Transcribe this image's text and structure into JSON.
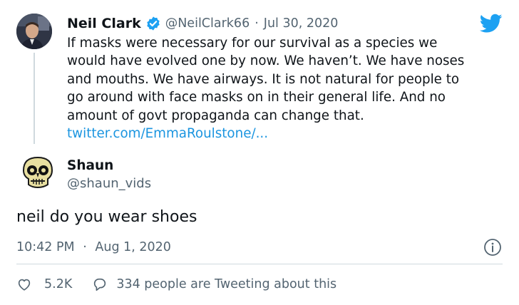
{
  "quoted_tweet": {
    "name": "Neil Clark",
    "handle": "@NeilClark66",
    "separator": "·",
    "date": "Jul 30, 2020",
    "lines": [
      "If masks were necessary for our survival as a species we",
      "would have evolved one by now. We haven’t. We have noses",
      "and mouths. We have airways. It is not natural for people to",
      "go around with face masks on in their general life. And no",
      "amount of govt propaganda can change that."
    ],
    "link": "twitter.com/EmmaRoulstone/..."
  },
  "reply": {
    "name": "Shaun",
    "handle": "@shaun_vids",
    "text": "neil do you wear shoes",
    "time": "10:42 PM",
    "separator": "·",
    "date": "Aug 1, 2020"
  },
  "stats": {
    "likes": "5.2K",
    "tweeting": "334 people are Tweeting about this"
  },
  "colors": {
    "brand_blue": "#1da1f2",
    "link_blue": "#1b95e0",
    "secondary_text": "#536471"
  },
  "icons": [
    "verified-badge-icon",
    "twitter-bird-icon",
    "info-icon",
    "heart-icon",
    "reply-bubble-icon"
  ]
}
